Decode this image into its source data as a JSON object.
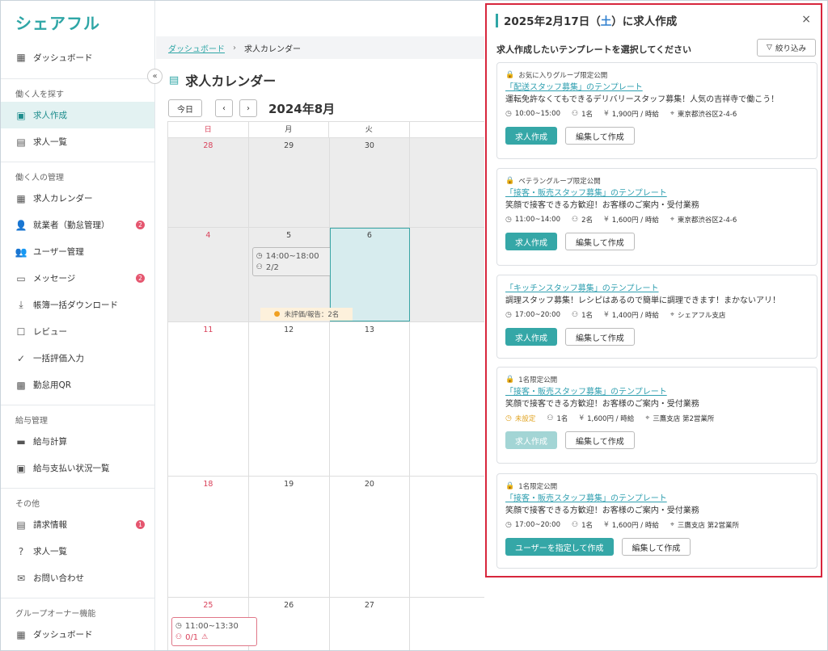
{
  "app": {
    "logo": "シェアフル"
  },
  "sidebar": {
    "dashboard": "ダッシュボード",
    "groups": [
      {
        "head": "働く人を探す",
        "items": [
          {
            "label": "求人作成",
            "icon": "job-create-icon",
            "active": true
          },
          {
            "label": "求人一覧",
            "icon": "job-list-icon"
          }
        ]
      },
      {
        "head": "働く人の管理",
        "items": [
          {
            "label": "求人カレンダー",
            "icon": "calendar-icon"
          },
          {
            "label": "就業者（勤怠管理）",
            "icon": "worker-icon",
            "badge": "2"
          },
          {
            "label": "ユーザー管理",
            "icon": "users-icon"
          },
          {
            "label": "メッセージ",
            "icon": "message-icon",
            "badge": "2"
          },
          {
            "label": "帳簿一括ダウンロード",
            "icon": "download-icon"
          },
          {
            "label": "レビュー",
            "icon": "review-icon"
          },
          {
            "label": "一括評価入力",
            "icon": "double-check-icon"
          },
          {
            "label": "勤怠用QR",
            "icon": "qr-icon"
          }
        ]
      },
      {
        "head": "給与管理",
        "items": [
          {
            "label": "給与計算",
            "icon": "card-icon"
          },
          {
            "label": "給与支払い状況一覧",
            "icon": "payment-icon"
          }
        ]
      },
      {
        "head": "その他",
        "items": [
          {
            "label": "請求情報",
            "icon": "invoice-icon",
            "badge": "1"
          },
          {
            "label": "求人一覧",
            "icon": "question-icon"
          },
          {
            "label": "お問い合わせ",
            "icon": "mail-icon"
          }
        ]
      },
      {
        "head": "グループオーナー機能",
        "items": [
          {
            "label": "ダッシュボード",
            "icon": "dashboard-icon"
          }
        ]
      }
    ]
  },
  "breadcrumb": {
    "home": "ダッシュボード",
    "sep": "›",
    "current": "求人カレンダー"
  },
  "page": {
    "title": "求人カレンダー"
  },
  "calendar": {
    "today_label": "今日",
    "prev": "‹",
    "next": "›",
    "month": "2024年8月",
    "weekdays": [
      "日",
      "月",
      "火"
    ],
    "weeks": [
      [
        "28",
        "29",
        "30"
      ],
      [
        "4",
        "5",
        "6"
      ],
      [
        "11",
        "12",
        "13"
      ],
      [
        "18",
        "19",
        "20"
      ],
      [
        "25",
        "26",
        "27"
      ]
    ],
    "shift_5": {
      "time": "14:00~18:00",
      "count": "2/2"
    },
    "notice_5": "未評価/報告：2名",
    "shift_25": {
      "time": "11:00~13:30",
      "count": "0/1"
    }
  },
  "panel": {
    "title_pre": "2025年2月17日（",
    "title_day": "土",
    "title_post": "）に求人作成",
    "close": "×",
    "subtitle": "求人作成したいテンプレートを選択してください",
    "filter": "絞り込み",
    "cards": [
      {
        "tag": "お気に入りグループ限定公開",
        "link": "「配送スタッフ募集」のテンプレート",
        "desc": "運転免許なくてもできるデリバリースタッフ募集！人気の吉祥寺で働こう！",
        "time": "10:00~15:00",
        "people": "1名",
        "wage": "1,900円 / 時給",
        "place": "東京都渋谷区2-4-6",
        "primary": "求人作成",
        "secondary": "編集して作成"
      },
      {
        "tag": "ベテラングループ限定公開",
        "link": "「接客・販売スタッフ募集」のテンプレート",
        "desc": "笑顔で接客できる方歓迎！お客様のご案内・受付業務",
        "time": "11:00~14:00",
        "people": "2名",
        "wage": "1,600円 / 時給",
        "place": "東京都渋谷区2-4-6",
        "primary": "求人作成",
        "secondary": "編集して作成"
      },
      {
        "tag": "",
        "link": "「キッチンスタッフ募集」のテンプレート",
        "desc": "調理スタッフ募集！レシピはあるので簡単に調理できます！まかないアリ！",
        "time": "17:00~20:00",
        "people": "1名",
        "wage": "1,400円 / 時給",
        "place": "シェアフル支店",
        "primary": "求人作成",
        "secondary": "編集して作成"
      },
      {
        "tag": "1名限定公開",
        "link": "「接客・販売スタッフ募集」のテンプレート",
        "desc": "笑顔で接客できる方歓迎！お客様のご案内・受付業務",
        "time": "未設定",
        "people": "1名",
        "wage": "1,600円 / 時給",
        "place": "三鷹支店 第2営業所",
        "primary": "求人作成",
        "secondary": "編集して作成"
      },
      {
        "tag": "1名限定公開",
        "link": "「接客・販売スタッフ募集」のテンプレート",
        "desc": "笑顔で接客できる方歓迎！お客様のご案内・受付業務",
        "time": "17:00~20:00",
        "people": "1名",
        "wage": "1,600円 / 時給",
        "place": "三鷹支店 第2営業所",
        "primary": "ユーザーを指定して作成",
        "secondary": "編集して作成"
      }
    ]
  },
  "colors": {
    "brand": "#2fa6a6",
    "highlight_border": "#d7263d",
    "badge": "#e5566f",
    "sunday": "#d9415a"
  }
}
